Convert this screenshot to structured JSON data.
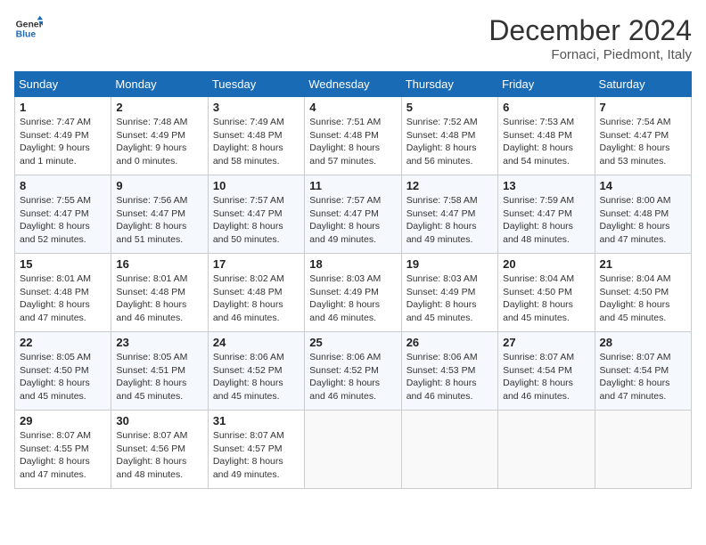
{
  "logo": {
    "line1": "General",
    "line2": "Blue"
  },
  "title": "December 2024",
  "location": "Fornaci, Piedmont, Italy",
  "headers": [
    "Sunday",
    "Monday",
    "Tuesday",
    "Wednesday",
    "Thursday",
    "Friday",
    "Saturday"
  ],
  "weeks": [
    [
      {
        "day": "1",
        "info": "Sunrise: 7:47 AM\nSunset: 4:49 PM\nDaylight: 9 hours\nand 1 minute."
      },
      {
        "day": "2",
        "info": "Sunrise: 7:48 AM\nSunset: 4:49 PM\nDaylight: 9 hours\nand 0 minutes."
      },
      {
        "day": "3",
        "info": "Sunrise: 7:49 AM\nSunset: 4:48 PM\nDaylight: 8 hours\nand 58 minutes."
      },
      {
        "day": "4",
        "info": "Sunrise: 7:51 AM\nSunset: 4:48 PM\nDaylight: 8 hours\nand 57 minutes."
      },
      {
        "day": "5",
        "info": "Sunrise: 7:52 AM\nSunset: 4:48 PM\nDaylight: 8 hours\nand 56 minutes."
      },
      {
        "day": "6",
        "info": "Sunrise: 7:53 AM\nSunset: 4:48 PM\nDaylight: 8 hours\nand 54 minutes."
      },
      {
        "day": "7",
        "info": "Sunrise: 7:54 AM\nSunset: 4:47 PM\nDaylight: 8 hours\nand 53 minutes."
      }
    ],
    [
      {
        "day": "8",
        "info": "Sunrise: 7:55 AM\nSunset: 4:47 PM\nDaylight: 8 hours\nand 52 minutes."
      },
      {
        "day": "9",
        "info": "Sunrise: 7:56 AM\nSunset: 4:47 PM\nDaylight: 8 hours\nand 51 minutes."
      },
      {
        "day": "10",
        "info": "Sunrise: 7:57 AM\nSunset: 4:47 PM\nDaylight: 8 hours\nand 50 minutes."
      },
      {
        "day": "11",
        "info": "Sunrise: 7:57 AM\nSunset: 4:47 PM\nDaylight: 8 hours\nand 49 minutes."
      },
      {
        "day": "12",
        "info": "Sunrise: 7:58 AM\nSunset: 4:47 PM\nDaylight: 8 hours\nand 49 minutes."
      },
      {
        "day": "13",
        "info": "Sunrise: 7:59 AM\nSunset: 4:47 PM\nDaylight: 8 hours\nand 48 minutes."
      },
      {
        "day": "14",
        "info": "Sunrise: 8:00 AM\nSunset: 4:48 PM\nDaylight: 8 hours\nand 47 minutes."
      }
    ],
    [
      {
        "day": "15",
        "info": "Sunrise: 8:01 AM\nSunset: 4:48 PM\nDaylight: 8 hours\nand 47 minutes."
      },
      {
        "day": "16",
        "info": "Sunrise: 8:01 AM\nSunset: 4:48 PM\nDaylight: 8 hours\nand 46 minutes."
      },
      {
        "day": "17",
        "info": "Sunrise: 8:02 AM\nSunset: 4:48 PM\nDaylight: 8 hours\nand 46 minutes."
      },
      {
        "day": "18",
        "info": "Sunrise: 8:03 AM\nSunset: 4:49 PM\nDaylight: 8 hours\nand 46 minutes."
      },
      {
        "day": "19",
        "info": "Sunrise: 8:03 AM\nSunset: 4:49 PM\nDaylight: 8 hours\nand 45 minutes."
      },
      {
        "day": "20",
        "info": "Sunrise: 8:04 AM\nSunset: 4:50 PM\nDaylight: 8 hours\nand 45 minutes."
      },
      {
        "day": "21",
        "info": "Sunrise: 8:04 AM\nSunset: 4:50 PM\nDaylight: 8 hours\nand 45 minutes."
      }
    ],
    [
      {
        "day": "22",
        "info": "Sunrise: 8:05 AM\nSunset: 4:50 PM\nDaylight: 8 hours\nand 45 minutes."
      },
      {
        "day": "23",
        "info": "Sunrise: 8:05 AM\nSunset: 4:51 PM\nDaylight: 8 hours\nand 45 minutes."
      },
      {
        "day": "24",
        "info": "Sunrise: 8:06 AM\nSunset: 4:52 PM\nDaylight: 8 hours\nand 45 minutes."
      },
      {
        "day": "25",
        "info": "Sunrise: 8:06 AM\nSunset: 4:52 PM\nDaylight: 8 hours\nand 46 minutes."
      },
      {
        "day": "26",
        "info": "Sunrise: 8:06 AM\nSunset: 4:53 PM\nDaylight: 8 hours\nand 46 minutes."
      },
      {
        "day": "27",
        "info": "Sunrise: 8:07 AM\nSunset: 4:54 PM\nDaylight: 8 hours\nand 46 minutes."
      },
      {
        "day": "28",
        "info": "Sunrise: 8:07 AM\nSunset: 4:54 PM\nDaylight: 8 hours\nand 47 minutes."
      }
    ],
    [
      {
        "day": "29",
        "info": "Sunrise: 8:07 AM\nSunset: 4:55 PM\nDaylight: 8 hours\nand 47 minutes."
      },
      {
        "day": "30",
        "info": "Sunrise: 8:07 AM\nSunset: 4:56 PM\nDaylight: 8 hours\nand 48 minutes."
      },
      {
        "day": "31",
        "info": "Sunrise: 8:07 AM\nSunset: 4:57 PM\nDaylight: 8 hours\nand 49 minutes."
      },
      null,
      null,
      null,
      null
    ]
  ]
}
